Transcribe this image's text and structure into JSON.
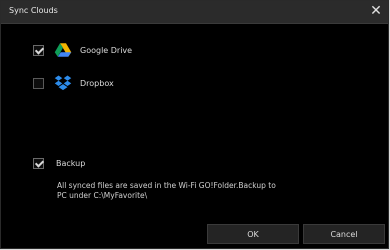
{
  "window": {
    "title": "Sync Clouds",
    "close_glyph": "✕"
  },
  "services": [
    {
      "label": "Google Drive",
      "checked": true,
      "icon": "google-drive-icon"
    },
    {
      "label": "Dropbox",
      "checked": false,
      "icon": "dropbox-icon"
    }
  ],
  "backup": {
    "label": "Backup",
    "checked": true,
    "description": "All synced files are saved in the Wi-Fi GO!Folder.Backup to PC under C:\\MyFavorite\\"
  },
  "buttons": {
    "ok": "OK",
    "cancel": "Cancel"
  }
}
